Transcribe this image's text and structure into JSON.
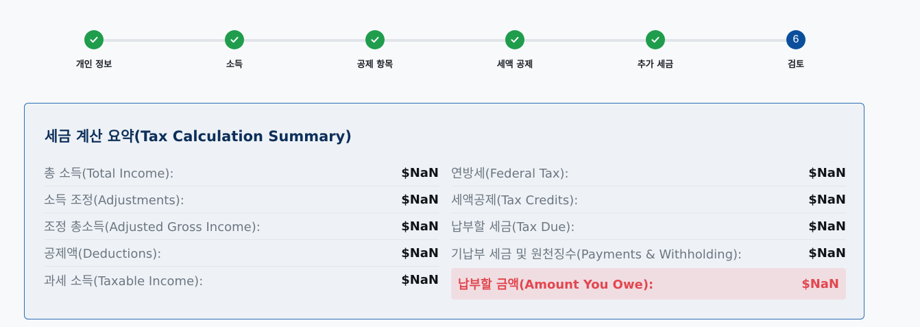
{
  "stepper": {
    "steps": [
      {
        "label": "개인 정보",
        "state": "done",
        "icon": "check-icon"
      },
      {
        "label": "소득",
        "state": "done",
        "icon": "check-icon"
      },
      {
        "label": "공제 항목",
        "state": "done",
        "icon": "check-icon"
      },
      {
        "label": "세액 공제",
        "state": "done",
        "icon": "check-icon"
      },
      {
        "label": "추가 세금",
        "state": "done",
        "icon": "check-icon"
      },
      {
        "label": "검토",
        "state": "current",
        "number": "6"
      }
    ]
  },
  "summary": {
    "title": "세금 계산 요약(Tax Calculation Summary)",
    "left": [
      {
        "label": "총 소득(Total Income):",
        "value": "$NaN"
      },
      {
        "label": "소득 조정(Adjustments):",
        "value": "$NaN"
      },
      {
        "label": "조정 총소득(Adjusted Gross Income):",
        "value": "$NaN"
      },
      {
        "label": "공제액(Deductions):",
        "value": "$NaN"
      },
      {
        "label": "과세 소득(Taxable Income):",
        "value": "$NaN"
      }
    ],
    "right": [
      {
        "label": "연방세(Federal Tax):",
        "value": "$NaN"
      },
      {
        "label": "세액공제(Tax Credits):",
        "value": "$NaN"
      },
      {
        "label": "납부할 세금(Tax Due):",
        "value": "$NaN"
      },
      {
        "label": "기납부 세금 및 원천징수(Payments & Withholding):",
        "value": "$NaN"
      }
    ],
    "amount_owed": {
      "label": "납부할 금액(Amount You Owe):",
      "value": "$NaN"
    }
  },
  "colors": {
    "step_done": "#1f9d4c",
    "step_current": "#0b4f9c",
    "title": "#0d2f5a",
    "owe_text": "#e2474f",
    "owe_bg": "#f0dde2"
  }
}
